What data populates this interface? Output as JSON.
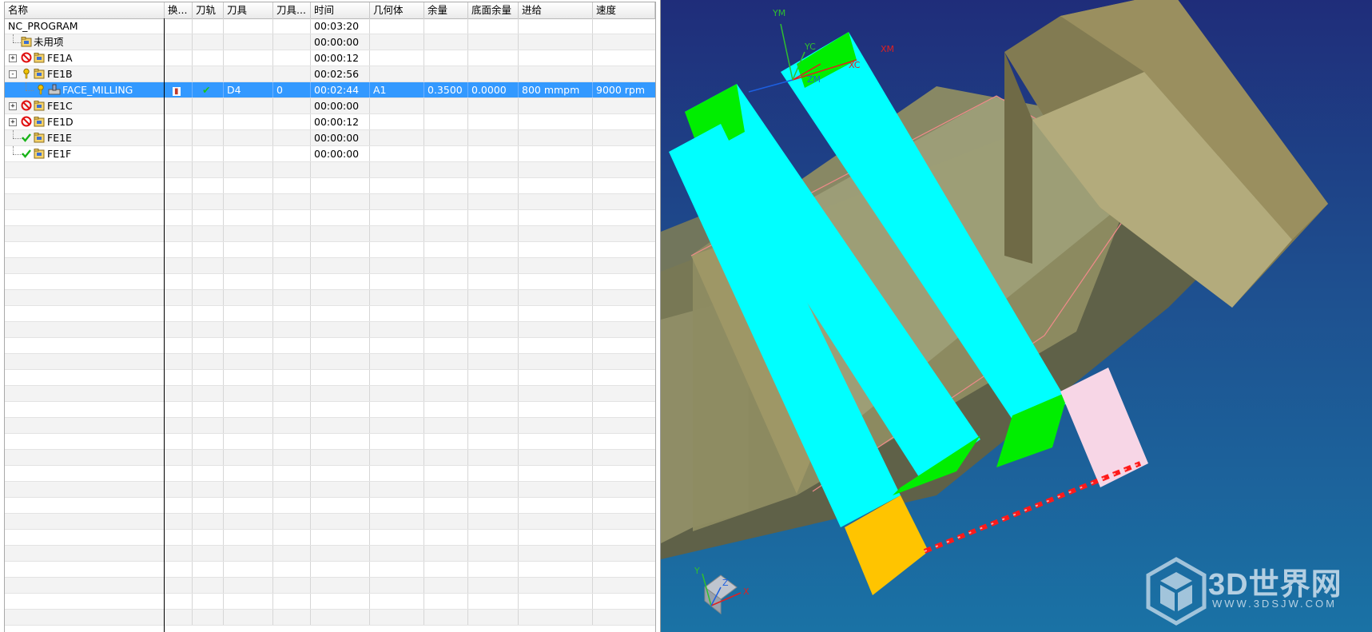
{
  "navigator": {
    "columns": [
      "名称",
      "换...",
      "刀轨",
      "刀具",
      "刀具...",
      "时间",
      "几何体",
      "余量",
      "底面余量",
      "进给",
      "速度"
    ],
    "rows": [
      {
        "name": "NC_PROGRAM",
        "level": 0,
        "icon": "none",
        "expander": "",
        "time": "00:03:20"
      },
      {
        "name": "未用项",
        "level": 1,
        "icon": "folder-icon",
        "expander": "",
        "time": "00:00:00"
      },
      {
        "name": "FE1A",
        "level": 1,
        "icon": "folder-icon",
        "status": "prohibited-icon",
        "expander": "+",
        "time": "00:00:12"
      },
      {
        "name": "FE1B",
        "level": 1,
        "icon": "folder-icon",
        "status": "key-icon",
        "expander": "-",
        "time": "00:02:56"
      },
      {
        "name": "FACE_MILLING",
        "level": 2,
        "icon": "face-milling-icon",
        "status": "key-icon",
        "expander": "",
        "selected": true,
        "toolchange": "▮",
        "path": "✔",
        "tool": "D4",
        "tool_num": "0",
        "time": "00:02:44",
        "geometry": "A1",
        "stock": "0.3500",
        "floor_stock": "0.0000",
        "feed": "800 mmpm",
        "speed": "9000 rpm"
      },
      {
        "name": "FE1C",
        "level": 1,
        "icon": "folder-icon",
        "status": "prohibited-icon",
        "expander": "+",
        "time": "00:00:00"
      },
      {
        "name": "FE1D",
        "level": 1,
        "icon": "folder-icon",
        "status": "prohibited-icon",
        "expander": "+",
        "time": "00:00:12"
      },
      {
        "name": "FE1E",
        "level": 1,
        "icon": "folder-icon",
        "status": "check-icon",
        "expander": "",
        "time": "00:00:00"
      },
      {
        "name": "FE1F",
        "level": 1,
        "icon": "folder-icon",
        "status": "check-icon",
        "expander": "",
        "time": "00:00:00"
      }
    ],
    "empty_row_count": 29
  },
  "viewport": {
    "axis_labels": {
      "ym": "YM",
      "yc": "YC",
      "xc": "XC",
      "xm": "XM",
      "zm": "ZM"
    },
    "triad_labels": {
      "x": "X",
      "y": "Y",
      "z": "Z"
    },
    "watermark": {
      "text": "3D世界网",
      "url": "WWW.3DSJW.COM"
    },
    "colors": {
      "cyan": "#00ffff",
      "green": "#00ee00",
      "orange": "#ffc400",
      "pink": "#f7d6e6",
      "red": "#ff1a1a",
      "block": "#a69c6e"
    }
  }
}
